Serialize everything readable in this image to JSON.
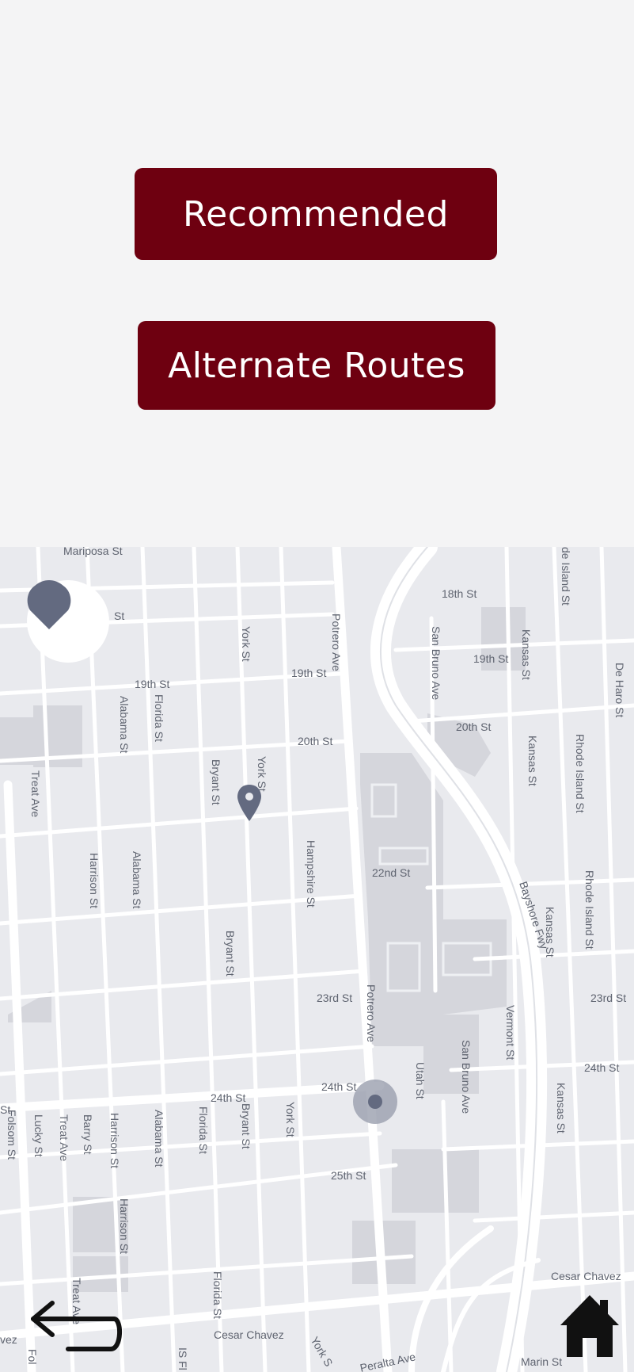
{
  "buttons": {
    "recommended": "Recommended",
    "alternate_routes": "Alternate Routes"
  },
  "colors": {
    "button_bg": "#6e0010",
    "button_text": "#ffffff",
    "page_bg": "#f4f4f5",
    "map_bg": "#e9eaee",
    "marker": "#636a80"
  },
  "map": {
    "streets": {
      "mariposa": "Mariposa St",
      "st_top": "St",
      "york_1": "York St",
      "potrero_1": "Potrero Ave",
      "eighteenth": "18th St",
      "island_top": "de Island St",
      "san_bruno_1": "San Bruno Ave",
      "kansas_1": "Kansas St",
      "de_haro": "De Haro St",
      "nineteenth_1": "19th St",
      "nineteenth_2": "19th St",
      "nineteenth_3": "19th St",
      "alabama_1": "Alabama St",
      "florida_1": "Florida St",
      "twentieth_1": "20th St",
      "twentieth_2": "20th St",
      "kansas_2": "Kansas St",
      "rhode_island_1": "Rhode Island St",
      "treat_1": "Treat Ave",
      "bryant_1": "Bryant St",
      "york_2": "York St",
      "harrison_1": "Harrison St",
      "alabama_2": "Alabama St",
      "hampshire": "Hampshire St",
      "twenty_second": "22nd St",
      "bayshore": "Bayshore Fwy",
      "kansas_3": "Kansas St",
      "rhode_island_2": "Rhode Island St",
      "bryant_2": "Bryant St",
      "twenty_third_1": "23rd St",
      "potrero_2": "Potrero Ave",
      "vermont": "Vermont St",
      "twenty_third_2": "23rd St",
      "san_bruno_2": "San Bruno Ave",
      "utah": "Utah St",
      "twenty_fourth_1": "24th St",
      "twenty_fourth_2": "24th St",
      "twenty_fourth_3": "24th St",
      "kansas_4": "Kansas St",
      "st_left": "St",
      "folsom": "Folsom St",
      "lucky": "Lucky St",
      "treat_2": "Treat Ave",
      "barry": "Barry St",
      "harrison_2": "Harrison St",
      "alabama_3": "Alabama St",
      "florida_2": "Florida St",
      "bryant_3": "Bryant St",
      "york_3": "York St",
      "twenty_fifth": "25th St",
      "harrison_3": "Harrison St",
      "treat_3": "Treat Ave",
      "florida_3": "Florida St",
      "cesar_chavez_1": "Cesar Chavez",
      "cesar_chavez_2": "Cesar Chavez",
      "marin": "Marin St",
      "peralta": "Peralta Ave",
      "york_4": "York S",
      "is_fl": "IS Fl",
      "fol": "Fol",
      "vez": "vez"
    }
  },
  "icons": {
    "locate": "location-drop-icon",
    "pin": "map-pin-icon",
    "current": "current-location-icon",
    "back": "back-arrow-icon",
    "home": "home-icon"
  }
}
